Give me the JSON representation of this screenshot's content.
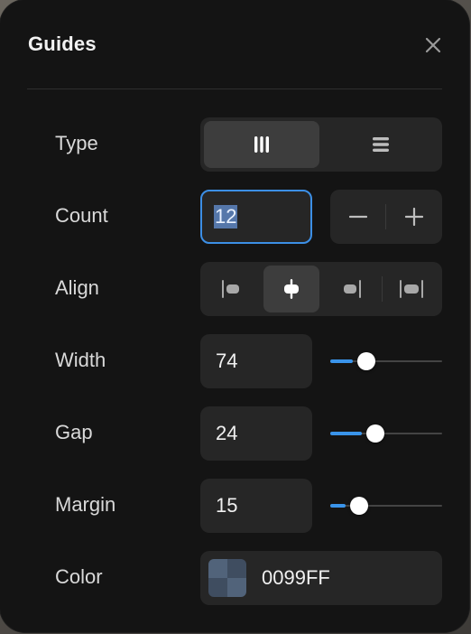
{
  "panel": {
    "title": "Guides"
  },
  "rows": {
    "type": {
      "label": "Type",
      "options": [
        "columns",
        "rows"
      ],
      "selected": "columns"
    },
    "count": {
      "label": "Count",
      "value": "12",
      "decrement_symbol": "−",
      "increment_symbol": "+"
    },
    "align": {
      "label": "Align",
      "options": [
        "left",
        "center",
        "right",
        "stretch"
      ],
      "selected": "center"
    },
    "width": {
      "label": "Width",
      "value": "74",
      "slider_level": 0.2
    },
    "gap": {
      "label": "Gap",
      "value": "24",
      "slider_level": 0.28
    },
    "margin": {
      "label": "Margin",
      "value": "15",
      "slider_level": 0.14
    },
    "color": {
      "label": "Color",
      "value": "0099FF"
    }
  },
  "colors": {
    "accent": "#3a94ea",
    "panel_bg": "#141414",
    "control_bg": "#262626",
    "active_segment": "#3d3d3d",
    "focus_ring": "#3c8fe6"
  },
  "icons": {
    "close": "close-icon",
    "type_columns": "columns-icon",
    "type_rows": "rows-icon",
    "align_left": "align-left-icon",
    "align_center": "align-center-icon",
    "align_right": "align-right-icon",
    "align_stretch": "align-stretch-icon",
    "decrement": "minus-icon",
    "increment": "plus-icon"
  }
}
